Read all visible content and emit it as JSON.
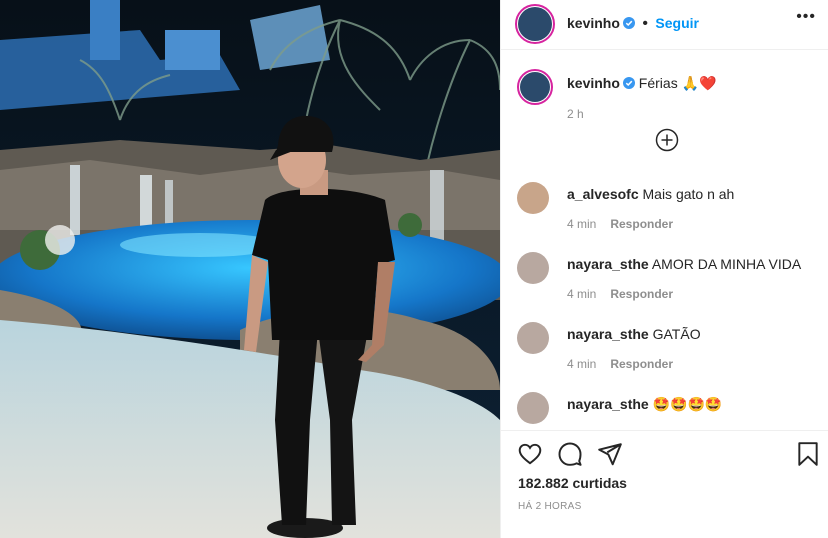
{
  "post": {
    "username": "kevinho",
    "follow_label": "Seguir",
    "caption_username": "kevinho",
    "caption_text": "Férias 🙏❤️",
    "caption_time": "2 h",
    "likes": "182.882 curtidas",
    "posted": "HÁ 2 HORAS"
  },
  "comments": [
    {
      "username": "a_alvesofc",
      "text": "Mais gato n ah",
      "time": "4 min",
      "reply": "Responder"
    },
    {
      "username": "nayara_sthe",
      "text": "AMOR DA MINHA VIDA",
      "time": "4 min",
      "reply": "Responder"
    },
    {
      "username": "nayara_sthe",
      "text": "GATÃO",
      "time": "4 min",
      "reply": "Responder"
    },
    {
      "username": "nayara_sthe",
      "text": "🤩🤩🤩🤩",
      "time": "",
      "reply": ""
    }
  ],
  "colors": {
    "accent": "#0095f6",
    "verified": "#3897f0",
    "muted": "#8e8e8e"
  }
}
